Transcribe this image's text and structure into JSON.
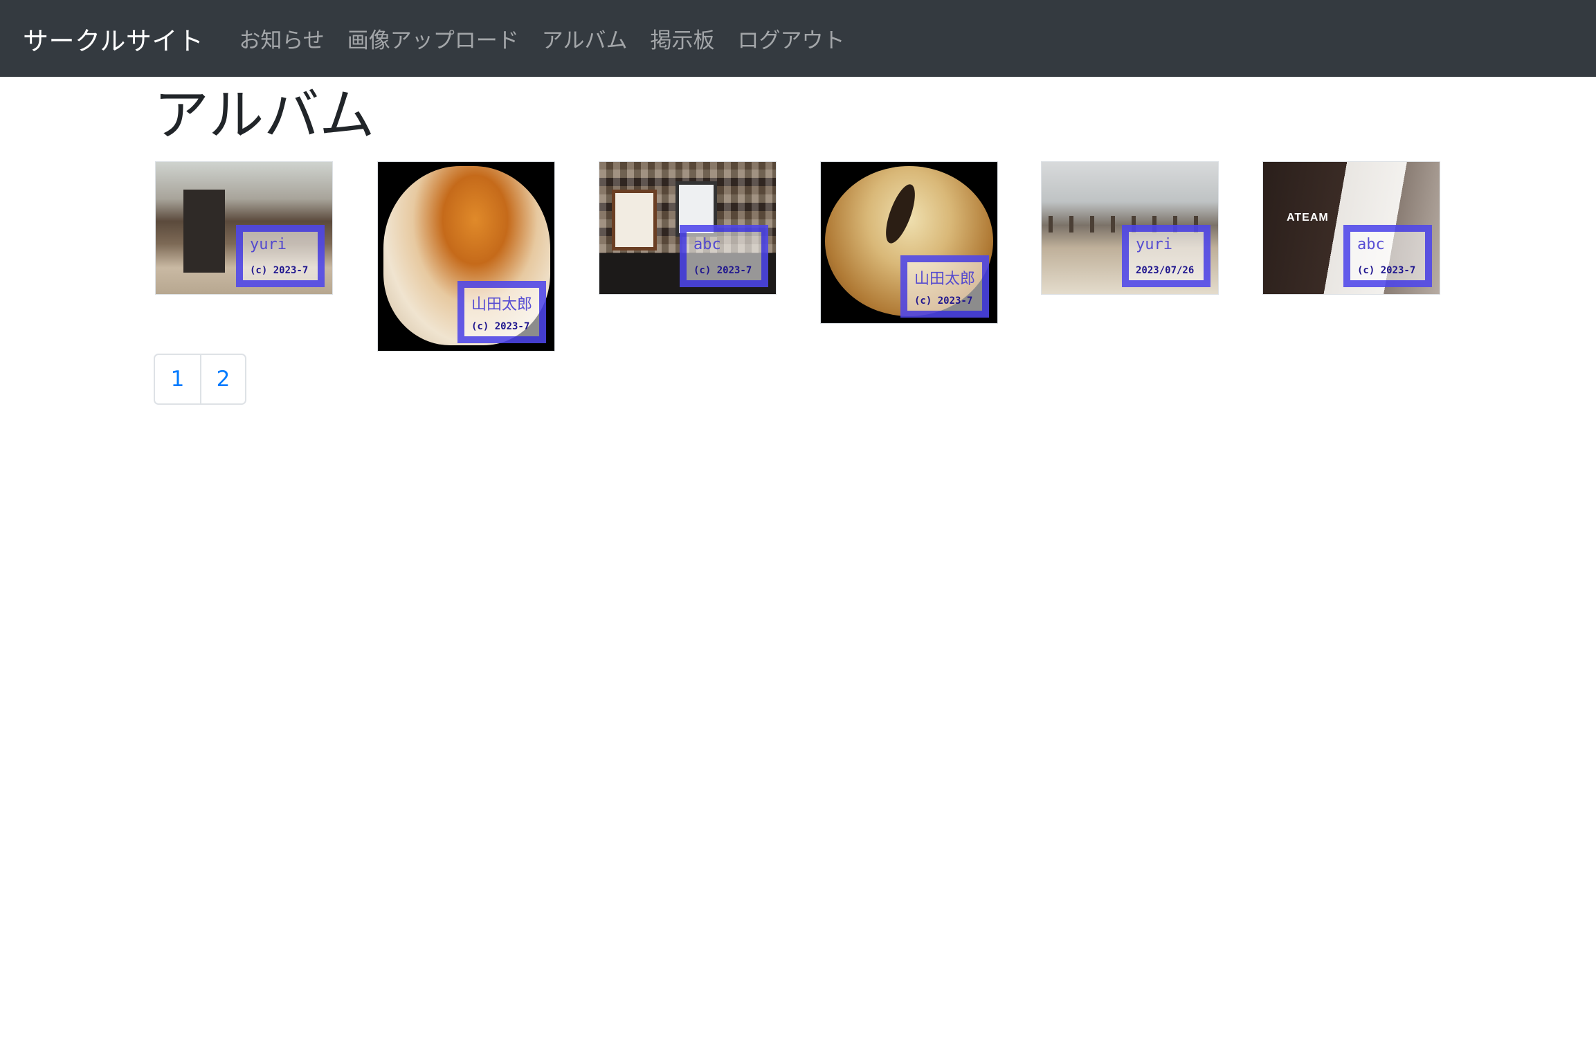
{
  "navbar": {
    "brand": "サークルサイト",
    "links": [
      "お知らせ",
      "画像アップロード",
      "アルバム",
      "掲示板",
      "ログアウト"
    ]
  },
  "page": {
    "title": "アルバム"
  },
  "album": {
    "photos": [
      {
        "watermark_name": "yuri",
        "watermark_line2": "(c) 2023-7"
      },
      {
        "watermark_name": "山田太郎",
        "watermark_line2": "(c) 2023-7"
      },
      {
        "watermark_name": "abc",
        "watermark_line2": "(c) 2023-7"
      },
      {
        "watermark_name": "山田太郎",
        "watermark_line2": "(c) 2023-7"
      },
      {
        "watermark_name": "yuri",
        "watermark_line2": "2023/07/26"
      },
      {
        "watermark_name": "abc",
        "watermark_line2": "(c) 2023-7",
        "logo_text": "ATEAM"
      }
    ]
  },
  "pagination": {
    "pages": [
      "1",
      "2"
    ]
  }
}
